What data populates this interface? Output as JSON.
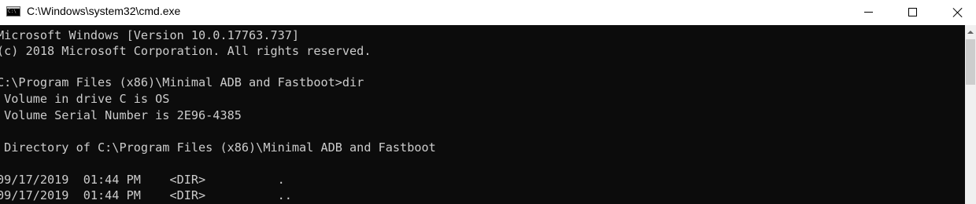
{
  "window": {
    "title": "C:\\Windows\\system32\\cmd.exe",
    "icon": "cmd-icon",
    "icon_text": "C:\\",
    "controls": {
      "minimize": "minimize-icon",
      "maximize": "maximize-icon",
      "close": "close-icon"
    }
  },
  "console": {
    "background": "#0c0c0c",
    "foreground": "#cccccc",
    "lines": [
      "Microsoft Windows [Version 10.0.17763.737]",
      "(c) 2018 Microsoft Corporation. All rights reserved.",
      "",
      "C:\\Program Files (x86)\\Minimal ADB and Fastboot>dir",
      " Volume in drive C is OS",
      " Volume Serial Number is 2E96-4385",
      "",
      " Directory of C:\\Program Files (x86)\\Minimal ADB and Fastboot",
      "",
      "09/17/2019  01:44 PM    <DIR>          .",
      "09/17/2019  01:44 PM    <DIR>          .."
    ]
  }
}
